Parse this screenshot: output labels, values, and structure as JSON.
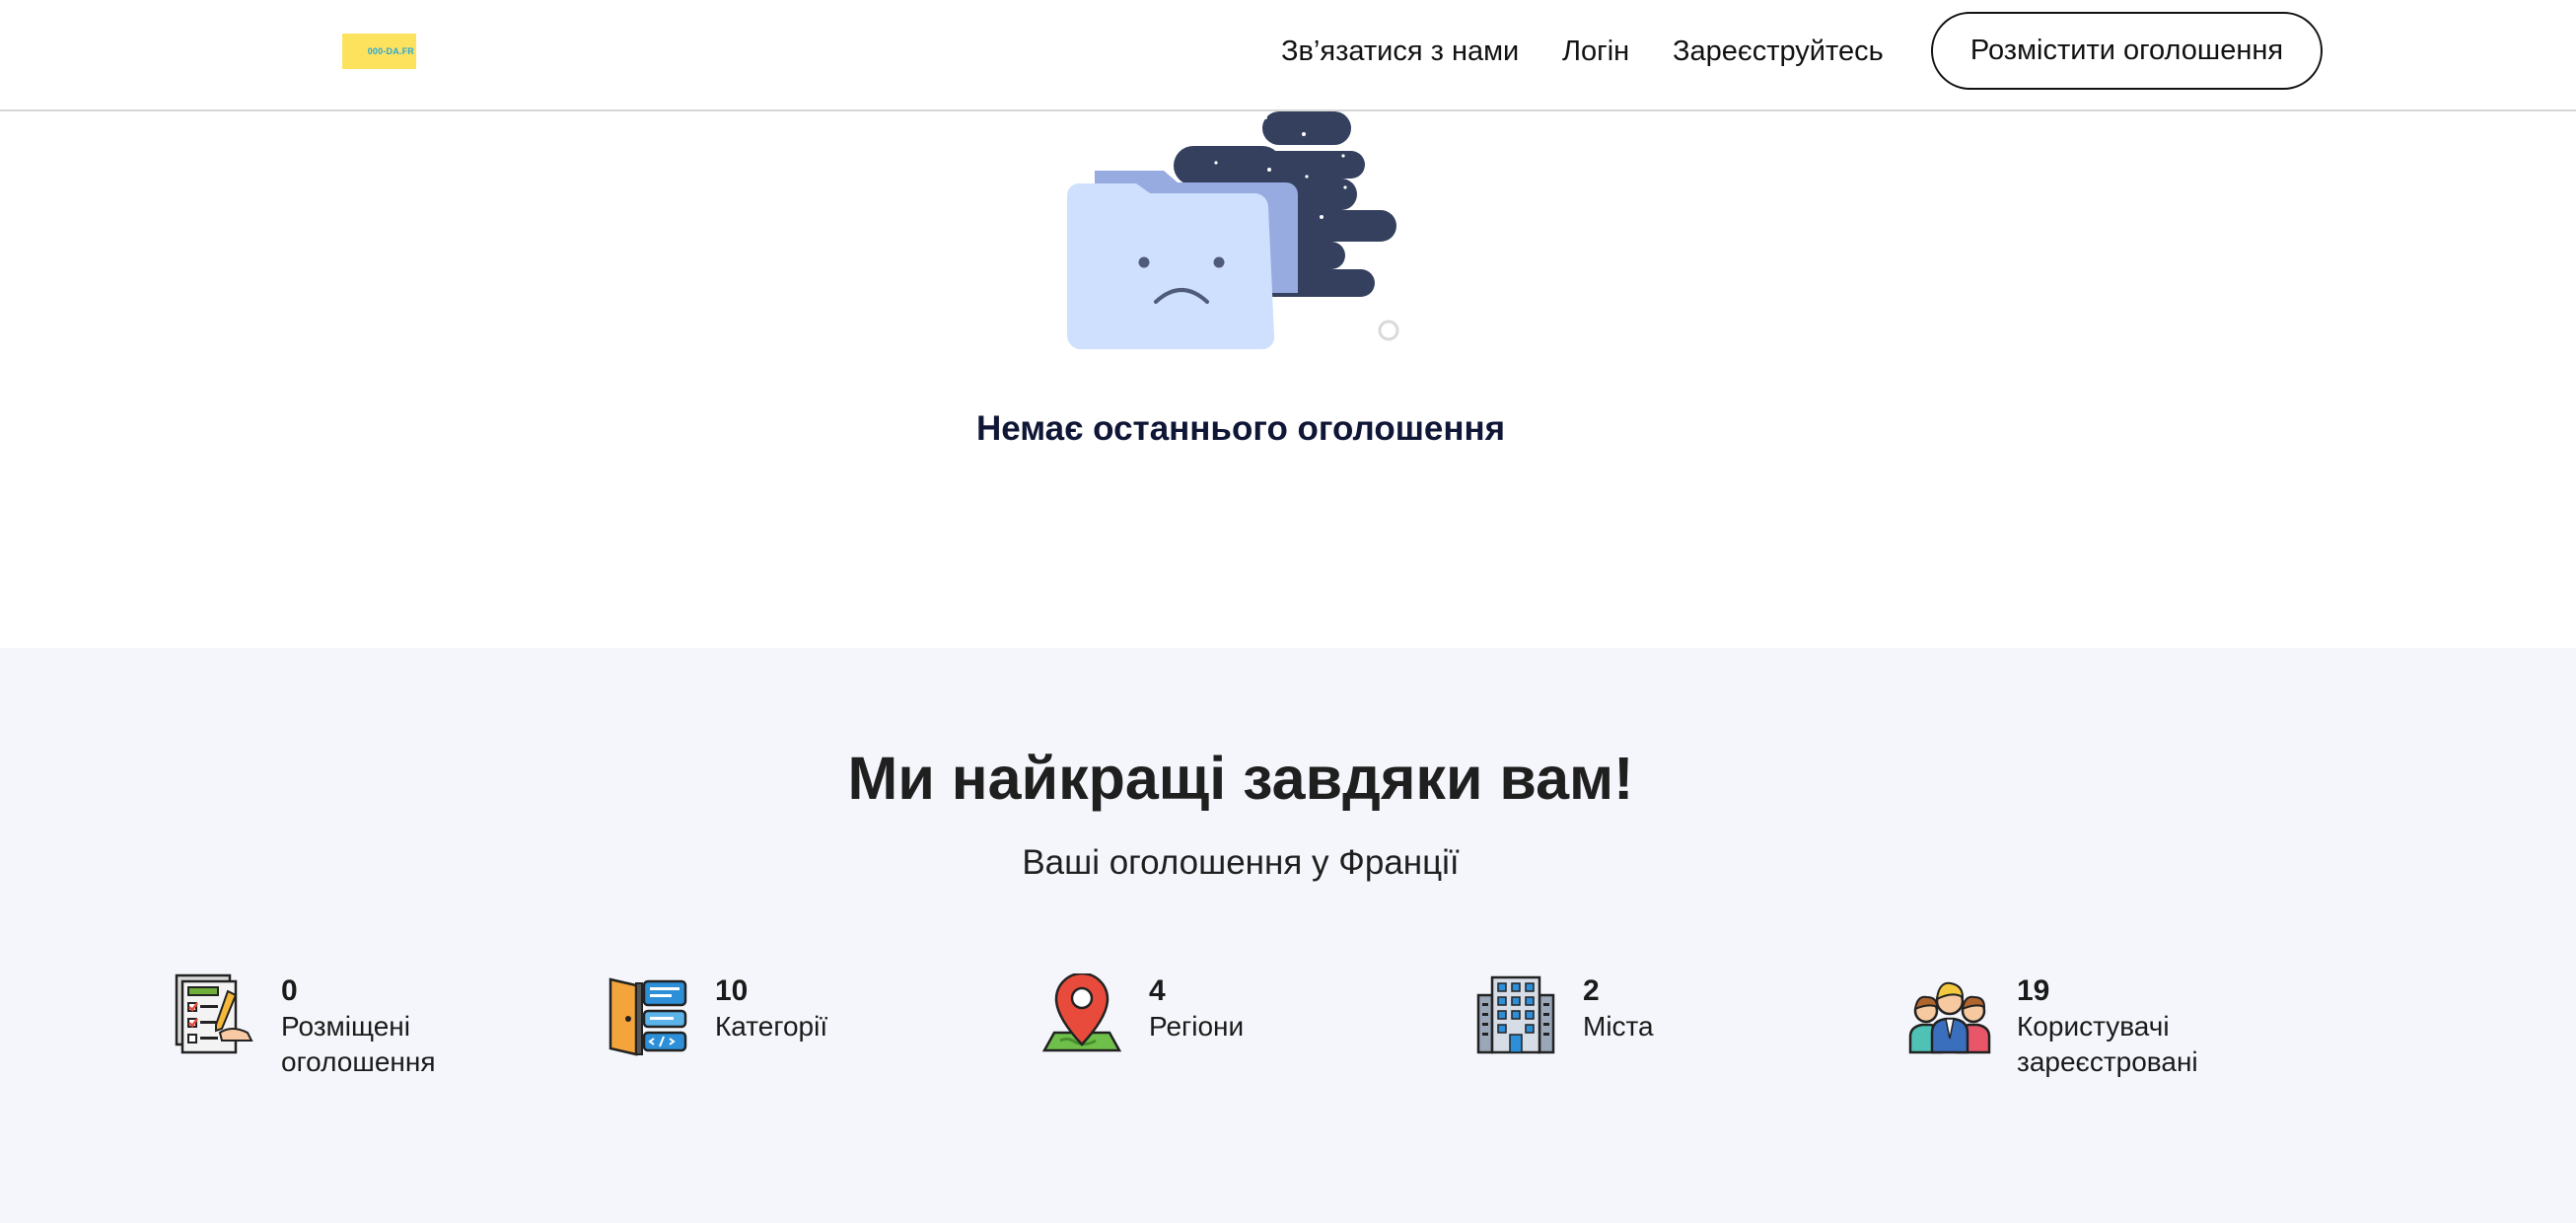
{
  "header": {
    "logo_text": "000-DA.FR",
    "nav": {
      "contact": "Зв’язатися з нами",
      "login": "Логін",
      "register": "Зареєструйтесь"
    },
    "post_ad": "Розмістити оголошення"
  },
  "empty_state": {
    "title": "Немає останнього оголошення",
    "icon": "sad-folder-illustration"
  },
  "stats": {
    "heading": "Ми найкращі завдяки вам!",
    "subheading": "Ваші оголошення у Франції",
    "items": [
      {
        "value": "0",
        "label": "Розміщені оголошення",
        "icon": "checklist-icon"
      },
      {
        "value": "10",
        "label": "Категорії",
        "icon": "door-categories-icon"
      },
      {
        "value": "4",
        "label": "Регіони",
        "icon": "map-pin-icon"
      },
      {
        "value": "2",
        "label": "Міста",
        "icon": "building-icon"
      },
      {
        "value": "19",
        "label": "Користувачі зареєстровані",
        "icon": "users-group-icon"
      }
    ]
  },
  "colors": {
    "logo_bg": "#fde25e",
    "stats_bg": "#f4f6fb",
    "heading_dark": "#0f1636"
  }
}
